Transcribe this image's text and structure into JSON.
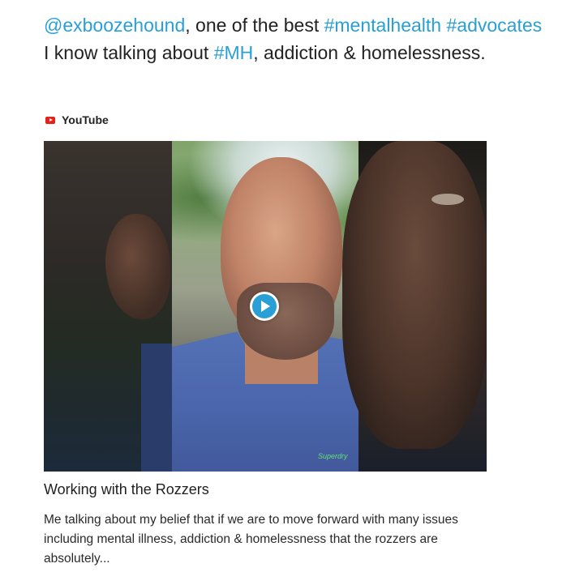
{
  "tweet": {
    "segments": [
      {
        "text": "@exboozehound",
        "link": true
      },
      {
        "text": ", one of the best ",
        "link": false
      },
      {
        "text": "#mentalhealth",
        "link": true
      },
      {
        "text": " ",
        "link": false
      },
      {
        "text": "#advocates",
        "link": true
      },
      {
        "text": " I know talking about ",
        "link": false
      },
      {
        "text": "#MH",
        "link": true
      },
      {
        "text": ", addiction & homelessness.",
        "link": false
      }
    ],
    "link_color": "#2a9fd6"
  },
  "card": {
    "source_icon": "youtube-icon",
    "source_label": "YouTube",
    "video_logo_text": "Superdry",
    "title": "Working with the Rozzers",
    "description": "Me talking about my belief that if we are to move forward with many issues including mental illness, addiction & homelessness that the rozzers are absolutely..."
  }
}
